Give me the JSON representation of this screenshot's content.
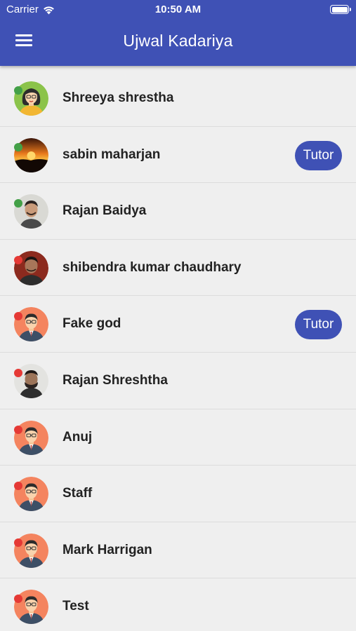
{
  "status_bar": {
    "carrier": "Carrier",
    "time": "10:50 AM"
  },
  "header": {
    "title": "Ujwal Kadariya",
    "menu_icon": "hamburger-menu-icon",
    "background": "#3f51b5"
  },
  "colors": {
    "online": "#43a047",
    "offline": "#e53935",
    "accent": "#3f51b5"
  },
  "contacts": [
    {
      "name": "Shreeya shrestha",
      "status": "online",
      "avatar": "female-avatar",
      "badge": ""
    },
    {
      "name": "sabin maharjan",
      "status": "online",
      "avatar": "sunset-photo",
      "badge": "Tutor"
    },
    {
      "name": "Rajan Baidya",
      "status": "online",
      "avatar": "photo-man-light",
      "badge": ""
    },
    {
      "name": "shibendra kumar chaudhary",
      "status": "offline",
      "avatar": "photo-man-red",
      "badge": ""
    },
    {
      "name": "Fake god",
      "status": "offline",
      "avatar": "male-default-avatar",
      "badge": "Tutor"
    },
    {
      "name": "Rajan Shreshtha",
      "status": "offline",
      "avatar": "photo-man-beard",
      "badge": ""
    },
    {
      "name": "Anuj",
      "status": "offline",
      "avatar": "male-default-avatar",
      "badge": ""
    },
    {
      "name": "Staff",
      "status": "offline",
      "avatar": "male-default-avatar",
      "badge": ""
    },
    {
      "name": "Mark Harrigan",
      "status": "offline",
      "avatar": "male-default-avatar",
      "badge": ""
    },
    {
      "name": "Test",
      "status": "offline",
      "avatar": "male-default-avatar",
      "badge": ""
    }
  ]
}
